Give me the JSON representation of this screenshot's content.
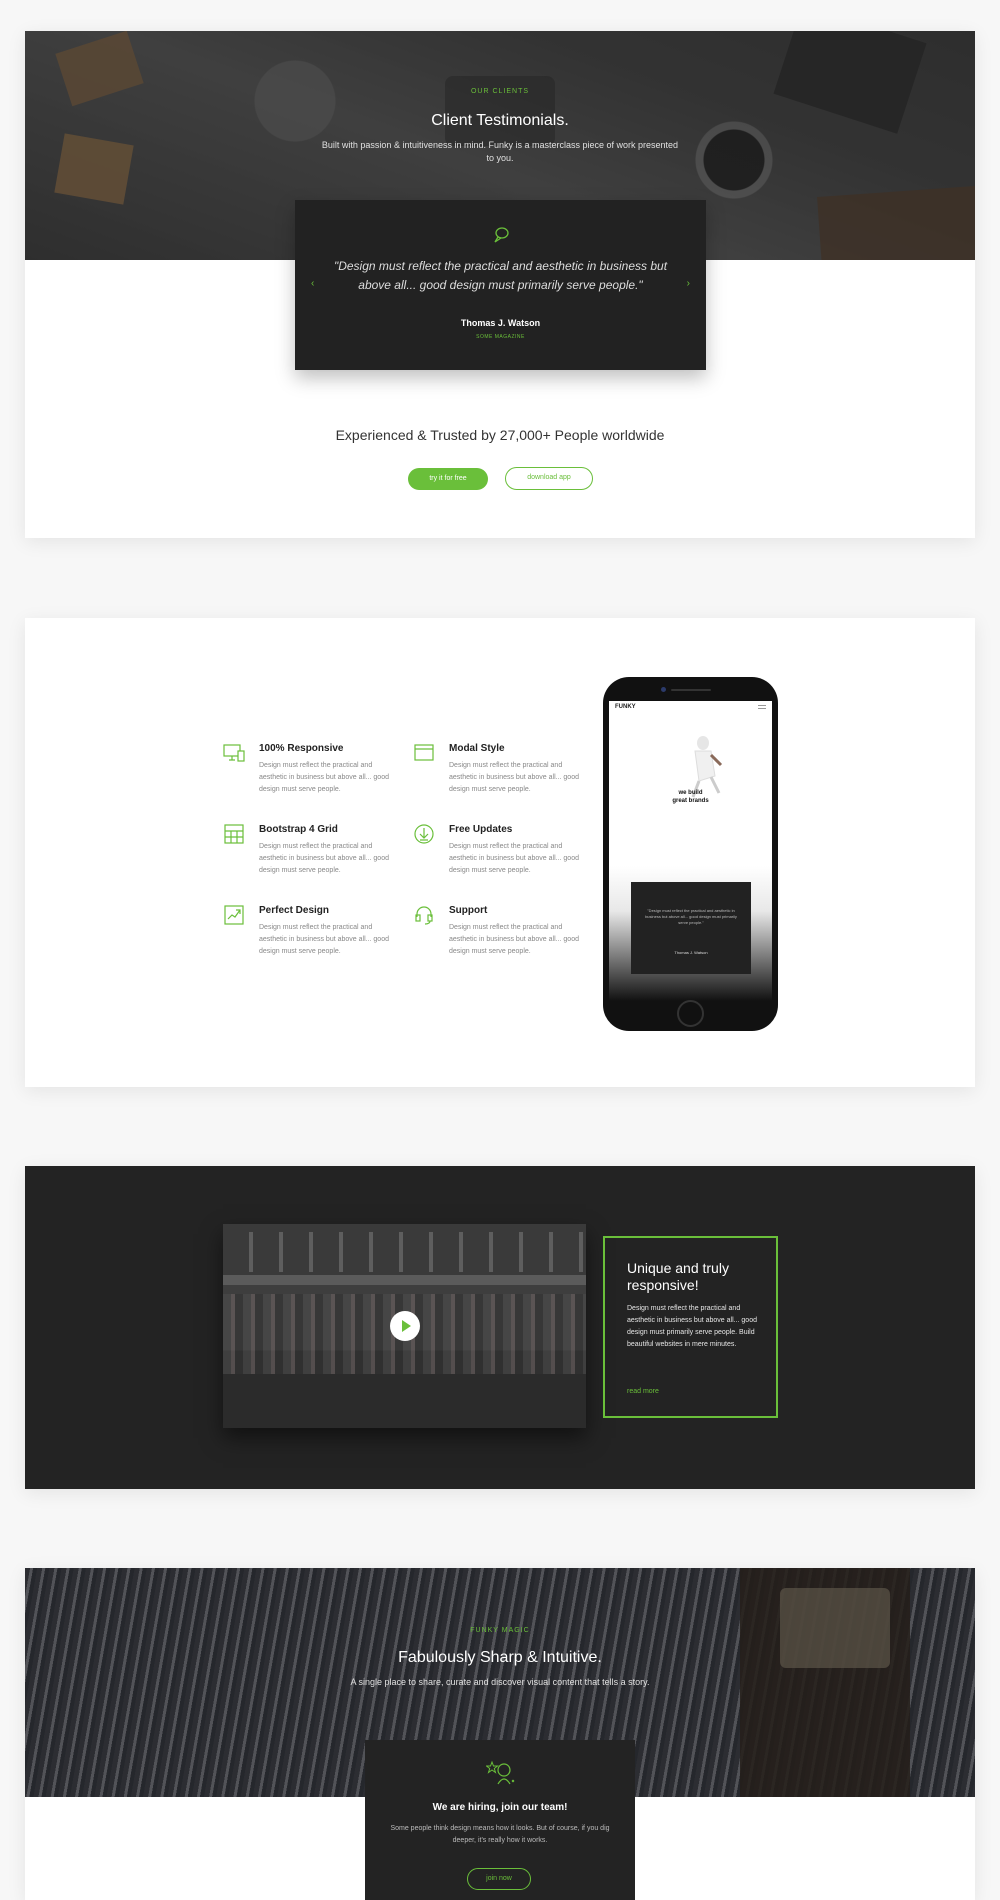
{
  "colors": {
    "accent": "#6abf3a",
    "dark": "#222222",
    "page_bg": "#f7f7f7"
  },
  "testimonials": {
    "eyebrow": "OUR CLIENTS",
    "title": "Client Testimonials.",
    "subtitle": "Built with passion & intuitiveness in mind. Funky is a masterclass piece of work presented to you.",
    "quote": "\"Design must reflect the practical and aesthetic in business but above all... good design must primarily serve people.\"",
    "author": "Thomas J. Watson",
    "org": "SOME MAGAZINE",
    "quote_icon": "speech-bubble-icon",
    "prev_icon": "chevron-left-icon",
    "next_icon": "chevron-right-icon"
  },
  "trusted": {
    "text": "Experienced & Trusted by 27,000+ People worldwide",
    "primary_button": "try it for free",
    "secondary_button": "download app"
  },
  "features": [
    {
      "icon": "monitor-icon",
      "title": "100% Responsive",
      "desc": "Design must reflect the practical and aesthetic in business but above all... good design must serve people."
    },
    {
      "icon": "window-icon",
      "title": "Modal Style",
      "desc": "Design must reflect the practical and aesthetic in business but above all... good design must serve people."
    },
    {
      "icon": "grid-icon",
      "title": "Bootstrap 4 Grid",
      "desc": "Design must reflect the practical and aesthetic in business but above all... good design must serve people."
    },
    {
      "icon": "download-icon",
      "title": "Free Updates",
      "desc": "Design must reflect the practical and aesthetic in business but above all... good design must serve people."
    },
    {
      "icon": "chart-icon",
      "title": "Perfect Design",
      "desc": "Design must reflect the practical and aesthetic in business but above all... good design must serve people."
    },
    {
      "icon": "headset-icon",
      "title": "Support",
      "desc": "Design must reflect the practical and aesthetic in business but above all... good design must serve people."
    }
  ],
  "phone": {
    "brand": "FUNKY",
    "caption_line1": "we build",
    "caption_line2": "great brands",
    "mini_quote": "\"Design must reflect the practical and aesthetic in business but above all... good design must primarily serve people.\"",
    "mini_author": "Thomas J. Watson"
  },
  "video_section": {
    "title": "Unique and truly responsive!",
    "desc": "Design must reflect the practical and aesthetic in business but above all... good design must primarily serve people. Build beautiful websites in mere minutes.",
    "link": "read more",
    "play_icon": "play-icon"
  },
  "hiring": {
    "eyebrow": "FUNKY MAGIC",
    "title": "Fabulously Sharp & Intuitive.",
    "subtitle": "A single place to share, curate and discover visual content that tells a story.",
    "card_title": "We are hiring, join our team!",
    "card_desc": "Some people think design means how it looks. But of course, if you dig deeper, it's really how it works.",
    "card_button": "join now",
    "card_icon": "team-star-icon"
  }
}
